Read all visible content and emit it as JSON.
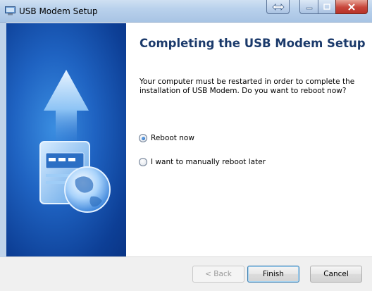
{
  "window": {
    "title": "USB Modem Setup"
  },
  "page": {
    "heading": "Completing the USB Modem Setup",
    "description": "Your computer must be restarted in order to complete the installation of USB Modem. Do you want to reboot now?"
  },
  "options": {
    "reboot_now": {
      "label": "Reboot now",
      "checked": true
    },
    "reboot_later": {
      "label": "I want to manually reboot later",
      "checked": false
    }
  },
  "buttons": {
    "back": "< Back",
    "finish": "Finish",
    "cancel": "Cancel"
  },
  "colors": {
    "heading": "#1b3a6b",
    "banner": "#1f63c2",
    "titlebar": "#b9d1ec",
    "close_button": "#c7453a"
  },
  "icons": {
    "app": "usb-modem-app-icon",
    "banner": "upload-arrow-and-globe-illustration"
  }
}
